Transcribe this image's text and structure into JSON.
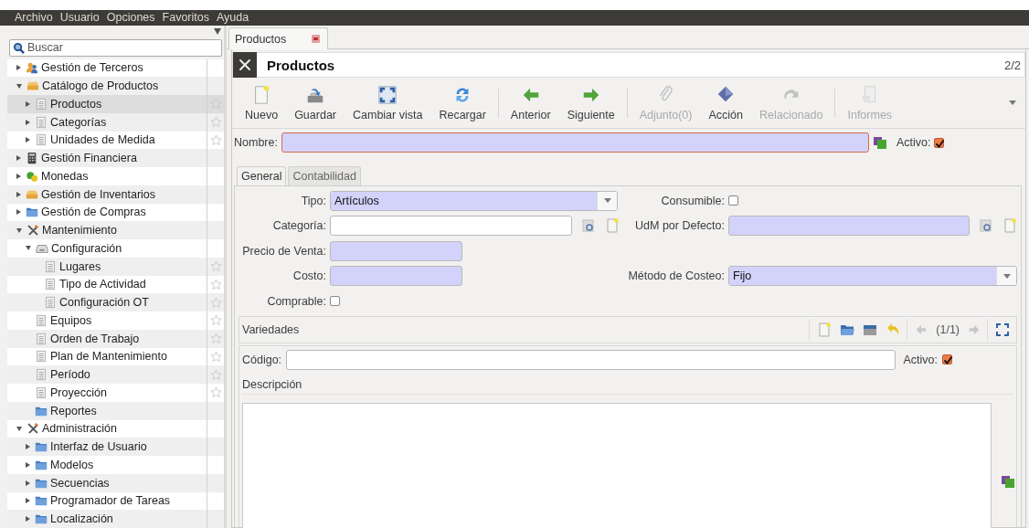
{
  "menubar": [
    "Archivo",
    "Usuario",
    "Opciones",
    "Favoritos",
    "Ayuda"
  ],
  "sidebar": {
    "search": {
      "placeholder": "Buscar"
    },
    "tree": [
      {
        "label": "Gestión de Terceros",
        "kind": "people",
        "expanded": false,
        "selected": false
      },
      {
        "label": "Catálogo de Productos",
        "kind": "box",
        "expanded": true,
        "selected": false,
        "children": [
          {
            "label": "Productos",
            "kind": "doc",
            "expanded": false,
            "selected": true,
            "favorite": false
          },
          {
            "label": "Categorías",
            "kind": "doc",
            "expanded": false,
            "selected": false,
            "favorite": false
          },
          {
            "label": "Unidades de Medida",
            "kind": "doc",
            "expanded": false,
            "selected": false,
            "favorite": false
          }
        ]
      },
      {
        "label": "Gestión Financiera",
        "kind": "calculator",
        "expanded": false,
        "selected": false
      },
      {
        "label": "Monedas",
        "kind": "coins",
        "expanded": false,
        "selected": false
      },
      {
        "label": "Gestión de Inventarios",
        "kind": "box",
        "expanded": false,
        "selected": false
      },
      {
        "label": "Gestión de Compras",
        "kind": "folder",
        "expanded": false,
        "selected": false
      },
      {
        "label": "Mantenimiento",
        "kind": "tools",
        "expanded": true,
        "selected": false,
        "children": [
          {
            "label": "Configuración",
            "kind": "tray",
            "expanded": true,
            "selected": false,
            "children": [
              {
                "label": "Lugares",
                "kind": "doc",
                "selected": false,
                "favorite": false
              },
              {
                "label": "Tipo de Actividad",
                "kind": "doc",
                "selected": false,
                "favorite": false
              },
              {
                "label": "Configuración OT",
                "kind": "doc",
                "selected": false,
                "favorite": false
              }
            ]
          },
          {
            "label": "Equipos",
            "kind": "doc",
            "selected": false,
            "favorite": false
          },
          {
            "label": "Orden de Trabajo",
            "kind": "doc",
            "selected": false,
            "favorite": false
          },
          {
            "label": "Plan de Mantenimiento",
            "kind": "doc",
            "selected": false,
            "favorite": false
          },
          {
            "label": "Período",
            "kind": "doc",
            "selected": false,
            "favorite": false
          },
          {
            "label": "Proyección",
            "kind": "doc",
            "selected": false,
            "favorite": false
          },
          {
            "label": "Reportes",
            "kind": "folder",
            "selected": false
          }
        ]
      },
      {
        "label": "Administración",
        "kind": "tools",
        "expanded": true,
        "selected": false,
        "children": [
          {
            "label": "Interfaz de Usuario",
            "kind": "folder",
            "expanded": false,
            "selected": false
          },
          {
            "label": "Modelos",
            "kind": "folder",
            "expanded": false,
            "selected": false
          },
          {
            "label": "Secuencias",
            "kind": "folder",
            "expanded": false,
            "selected": false
          },
          {
            "label": "Programador de Tareas",
            "kind": "folder",
            "expanded": false,
            "selected": false
          },
          {
            "label": "Localización",
            "kind": "folder",
            "expanded": false,
            "selected": false
          }
        ]
      }
    ]
  },
  "tabs": [
    {
      "label": "Productos",
      "selected": true
    }
  ],
  "header": {
    "title": "Productos",
    "record_count": "2/2"
  },
  "toolbar": {
    "groups": [
      [
        {
          "label": "Nuevo",
          "kind": "new",
          "disabled": false
        },
        {
          "label": "Guardar",
          "kind": "save",
          "disabled": false
        },
        {
          "label": "Cambiar vista",
          "kind": "switch",
          "disabled": false
        },
        {
          "label": "Recargar",
          "kind": "reload",
          "disabled": false
        }
      ],
      [
        {
          "label": "Anterior",
          "kind": "previous",
          "disabled": false
        },
        {
          "label": "Siguiente",
          "kind": "next",
          "disabled": false
        }
      ],
      [
        {
          "label": "Adjunto(0)",
          "kind": "attach",
          "disabled": true
        },
        {
          "label": "Acción",
          "kind": "action",
          "disabled": false
        },
        {
          "label": "Relacionado",
          "kind": "relate",
          "disabled": true
        }
      ],
      [
        {
          "label": "Informes",
          "kind": "print",
          "disabled": true
        }
      ]
    ]
  },
  "form": {
    "name": {
      "label": "Nombre:",
      "required": true,
      "focused": true
    },
    "active": {
      "label": "Activo:",
      "checked": true
    },
    "tabs": [
      {
        "label": "General",
        "selected": true
      },
      {
        "label": "Contabilidad",
        "selected": false
      }
    ],
    "rows": [
      [
        {
          "kind": "select",
          "label": "Tipo:",
          "value": "Artículos",
          "required": true
        },
        {
          "kind": "checkbox",
          "label": "Consumible:",
          "checked": false
        }
      ],
      [
        {
          "kind": "many2one",
          "label": "Categoría:",
          "required": false
        },
        {
          "kind": "many2one",
          "label": "UdM por Defecto:",
          "required": true
        }
      ],
      [
        {
          "kind": "char",
          "label": "Precio de Venta:",
          "required": true
        }
      ],
      [
        {
          "kind": "char",
          "label": "Costo:",
          "required": true
        },
        {
          "kind": "select",
          "label": "Método de Costeo:",
          "value": "Fijo",
          "required": true
        }
      ],
      [
        {
          "kind": "checkbox",
          "label": "Comprable:",
          "checked": false
        }
      ]
    ],
    "variants": {
      "title": "Variedades",
      "pager": "(1/1)",
      "code": {
        "label": "Código:",
        "required": false
      },
      "active": {
        "label": "Activo:",
        "checked": true
      },
      "description": {
        "label": "Descripción"
      }
    }
  }
}
